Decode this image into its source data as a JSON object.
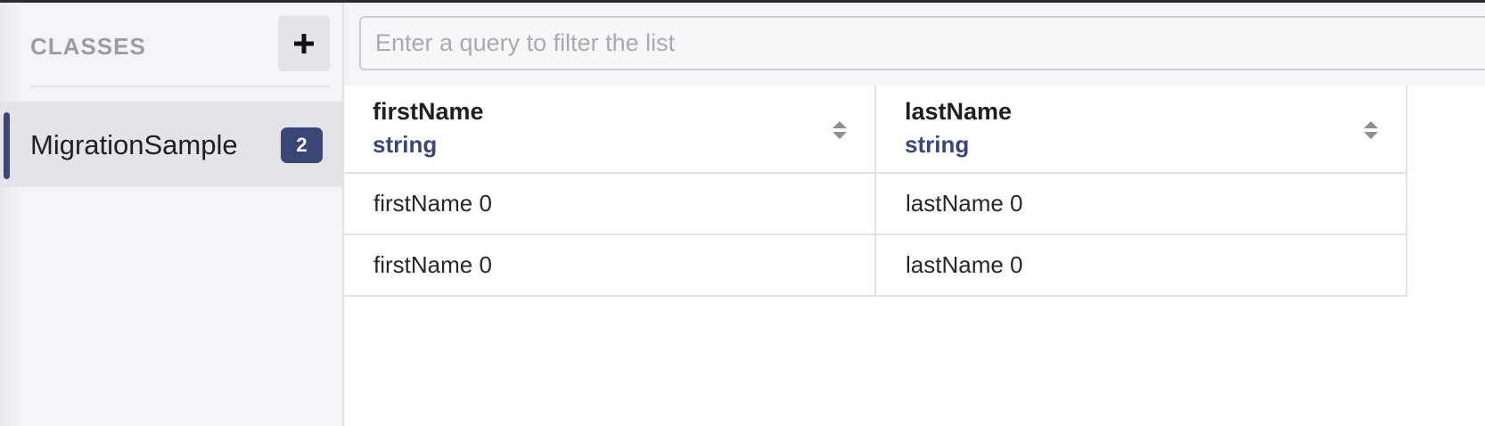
{
  "sidebar": {
    "title": "CLASSES",
    "add_icon": "plus-icon",
    "classes": [
      {
        "label": "MigrationSample",
        "count": "2",
        "selected": true
      }
    ]
  },
  "filter": {
    "placeholder": "Enter a query to filter the list",
    "value": ""
  },
  "table": {
    "columns": [
      {
        "name": "firstName",
        "type": "string",
        "sort_icon": "sort-icon"
      },
      {
        "name": "lastName",
        "type": "string",
        "sort_icon": "sort-icon"
      }
    ],
    "rows": [
      {
        "cells": [
          "firstName 0",
          "lastName 0"
        ]
      },
      {
        "cells": [
          "firstName 0",
          "lastName 0"
        ]
      }
    ]
  },
  "colors": {
    "accent": "#3b4677",
    "sidebar_bg": "#f3f3f8",
    "selected_bg": "#e3e3ea"
  }
}
